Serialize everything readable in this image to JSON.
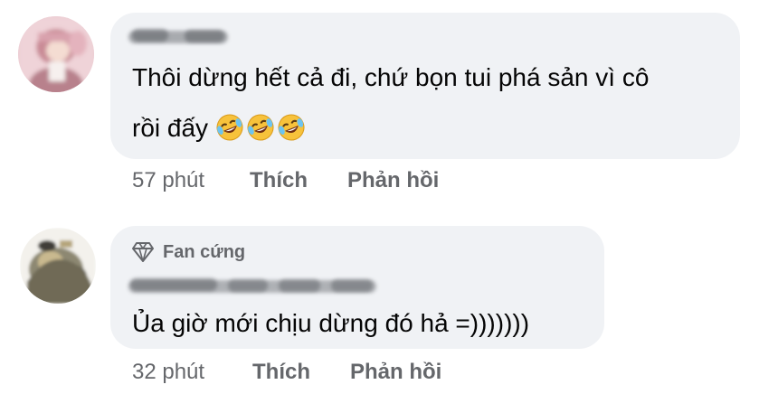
{
  "comments": [
    {
      "text_line1": "Thôi dừng hết cả đi, chứ bọn tui phá sản vì cô",
      "text_line2": "rồi đấy",
      "emoji": [
        "rolling-on-floor-laughing",
        "rolling-on-floor-laughing",
        "rolling-on-floor-laughing"
      ],
      "time": "57 phút",
      "like_label": "Thích",
      "reply_label": "Phản hồi"
    },
    {
      "badge": "Fan cứng",
      "text": "Ủa giờ mới chịu dừng đó hả =)))))))",
      "time": "32 phút",
      "like_label": "Thích",
      "reply_label": "Phản hồi"
    }
  ],
  "colors": {
    "bubble": "#f0f2f5",
    "text": "#050505",
    "meta": "#65676b"
  }
}
